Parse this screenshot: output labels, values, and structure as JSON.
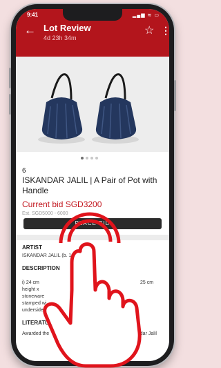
{
  "status_bar": {
    "time": "9:41",
    "icons": "▂▄▆ ≋ ▭"
  },
  "header": {
    "back_icon": "←",
    "title": "Lot Review",
    "subtitle": "4d 23h 34m",
    "star_icon": "☆",
    "more_icon": "⋮"
  },
  "gallery": {
    "image_count": 4,
    "active_index": 0
  },
  "lot": {
    "number": "6",
    "title": "ISKANDAR JALIL | A Pair of Pot with Handle",
    "current_bid": "Current bid SGD3200",
    "estimate": "Est. SGD5000 - 6000",
    "bid_button": "PLACE BID"
  },
  "artist": {
    "heading": "ARTIST",
    "name": "ISKANDAR JALIL (b. 1940)"
  },
  "description": {
    "heading": "DESCRIPTION",
    "line1": "i) 24 cm",
    "line2": "height x",
    "line3": "stoneware",
    "line4": "stamped wi",
    "line5": "underside each",
    "right_text": "25 cm"
  },
  "literature": {
    "heading": "LITERATURE",
    "line1": "Awarded the",
    "line1_right": "skandar Jalil"
  },
  "colors": {
    "brand": "#b3151c",
    "hand_outline": "#e0141c"
  }
}
